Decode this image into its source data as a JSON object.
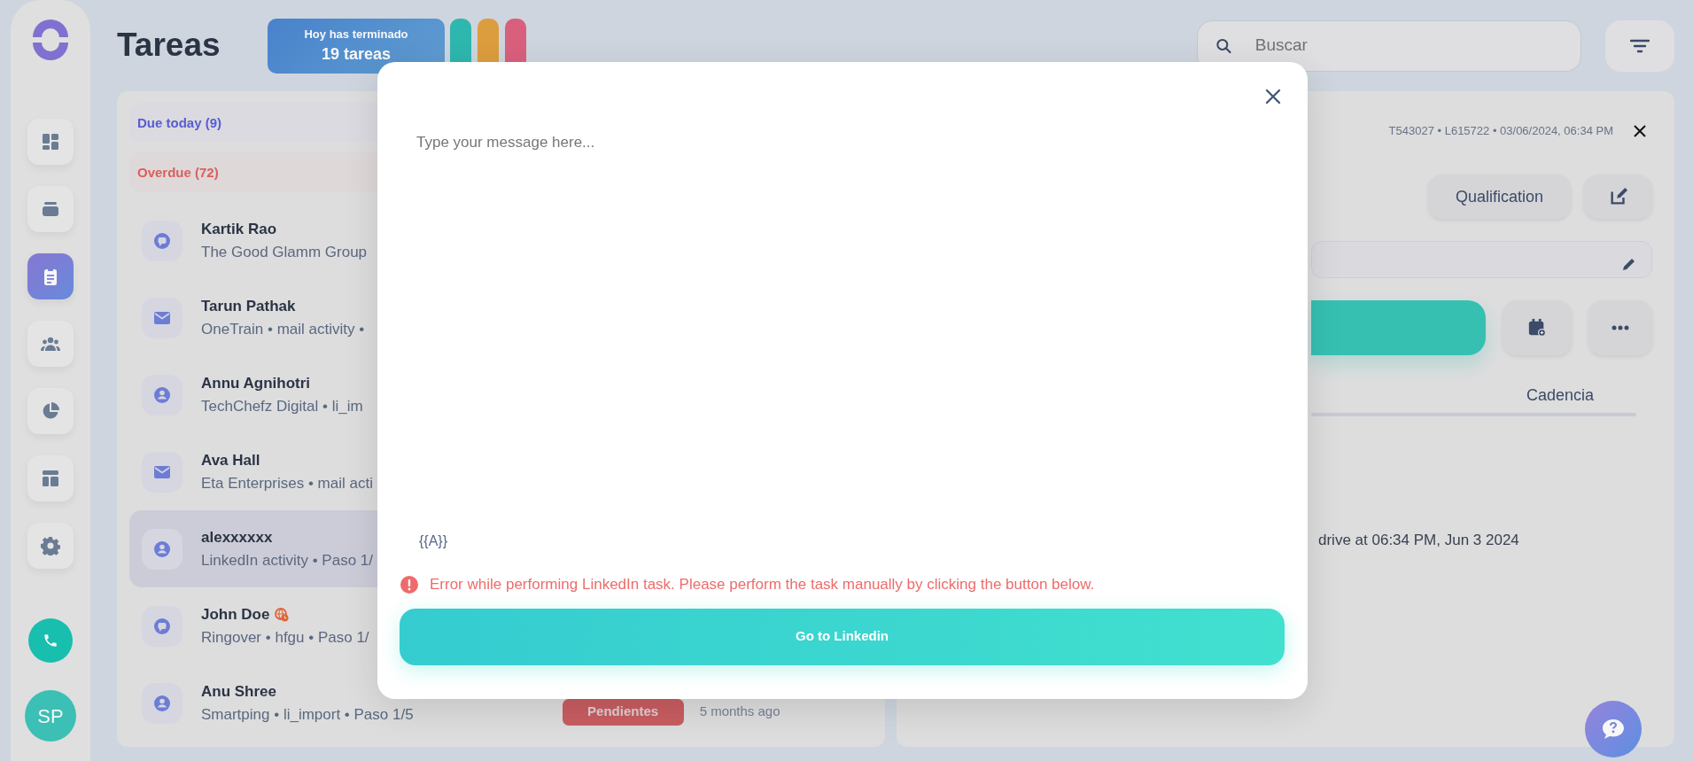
{
  "sidebar": {
    "items": [
      {
        "kind": "dashboard",
        "selected": false
      },
      {
        "kind": "stack",
        "selected": false
      },
      {
        "kind": "tasks",
        "selected": true
      },
      {
        "kind": "people",
        "selected": false
      },
      {
        "kind": "chart",
        "selected": false
      },
      {
        "kind": "layout",
        "selected": false
      },
      {
        "kind": "settings",
        "selected": false
      }
    ],
    "avatar": "SP"
  },
  "header": {
    "title": "Tareas",
    "summary": {
      "caption": "Hoy has terminado",
      "value": "19 tareas"
    },
    "pills": [
      {
        "color": "#2ebdb4"
      },
      {
        "color": "#e3a23e"
      },
      {
        "color": "#e0627f"
      }
    ],
    "search": {
      "placeholder": "Buscar"
    }
  },
  "task_list": {
    "groups": [
      {
        "label": "Due today (9)",
        "kind": "due"
      },
      {
        "label": "Overdue (72)",
        "kind": "overdue"
      }
    ],
    "tasks": [
      {
        "kind": "chat",
        "name": "Kartik Rao",
        "subtitle": "The Good Glamm Group",
        "selected": false
      },
      {
        "kind": "mail",
        "name": "Tarun Pathak",
        "subtitle": "OneTrain • mail activity •",
        "selected": false
      },
      {
        "kind": "person",
        "name": "Annu Agnihotri",
        "subtitle": "TechChefz Digital • li_im",
        "selected": false
      },
      {
        "kind": "mail",
        "name": "Ava Hall",
        "subtitle": "Eta Enterprises • mail acti",
        "selected": false
      },
      {
        "kind": "person",
        "name": "alexxxxxx",
        "subtitle": "LinkedIn activity • Paso 1/",
        "selected": true
      },
      {
        "kind": "chat",
        "name": "John Doe",
        "subtitle": "Ringover • hfgu • Paso 1/",
        "selected": false,
        "timezone_alert": true
      },
      {
        "kind": "person",
        "name": "Anu Shree",
        "subtitle": "Smartping • li_import • Paso 1/5",
        "selected": false,
        "status": "Pendientes",
        "time": "5 months ago"
      }
    ]
  },
  "task_detail": {
    "meta": "T543027 • L615722 • 03/06/2024, 06:34 PM",
    "button": "Qualification",
    "tabs": [
      {
        "label": "Cadencia",
        "selected": false
      }
    ],
    "activity": "drive at 06:34 PM, Jun 3 2024"
  },
  "modal": {
    "message": {
      "placeholder": "Type your message here..."
    },
    "variable": "{{A}}",
    "error": "Error while performing LinkedIn task. Please perform the task manually by clicking the button below.",
    "action": "Go to Linkedin"
  }
}
